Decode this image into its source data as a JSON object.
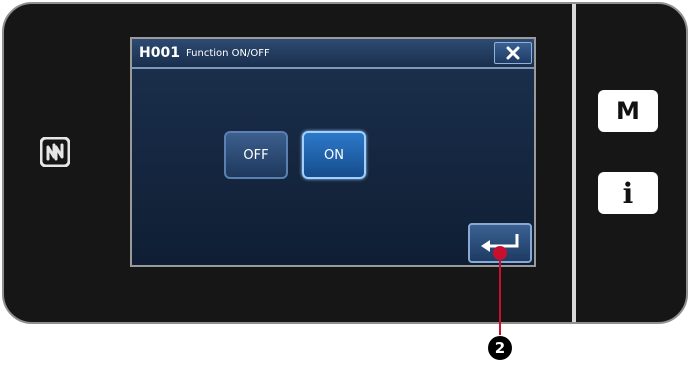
{
  "dialog": {
    "code": "H001",
    "title": "Function ON/OFF",
    "off_label": "OFF",
    "on_label": "ON"
  },
  "hardware": {
    "menu_label": "M",
    "info_label": "i"
  },
  "callout": {
    "number": "2"
  },
  "icons": {
    "close": "close-icon",
    "enter": "enter-arrow-icon",
    "nfc": "nfc-icon"
  },
  "colors": {
    "selected_button": "#2c79c9",
    "callout_red": "#c8102e"
  }
}
